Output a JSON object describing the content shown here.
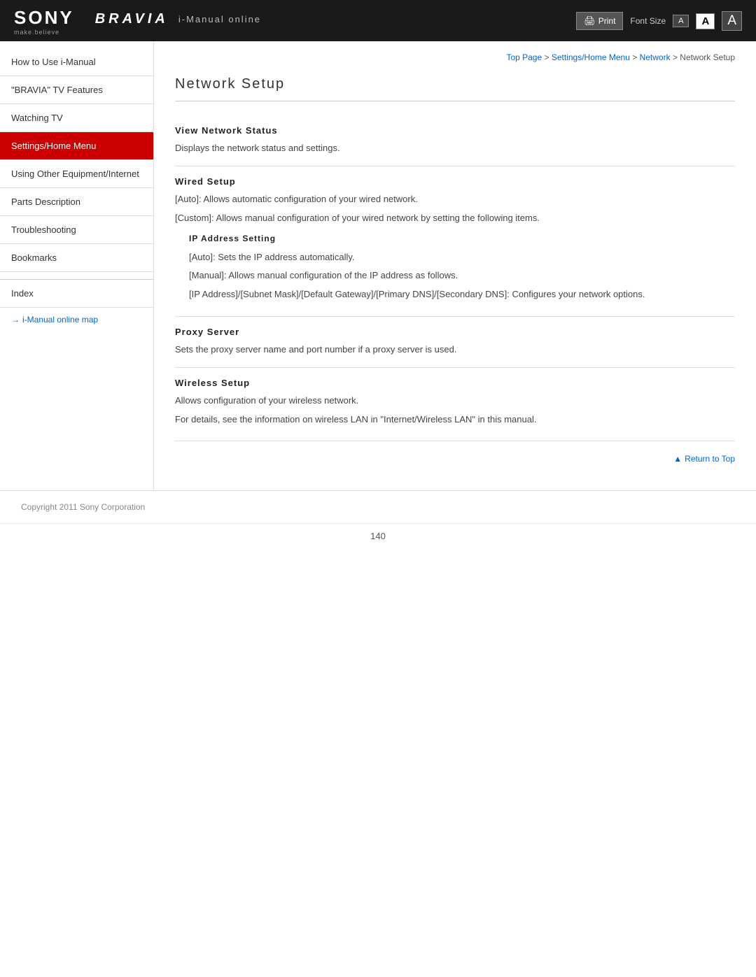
{
  "header": {
    "sony_logo": "SONY",
    "make_believe": "make.believe",
    "bravia_logo": "BRAVIA",
    "i_manual_text": "i-Manual online",
    "print_label": "Print",
    "font_size_label": "Font Size",
    "font_btn_small": "A",
    "font_btn_medium": "A",
    "font_btn_large": "A"
  },
  "breadcrumb": {
    "top_page": "Top Page",
    "separator1": " > ",
    "settings": "Settings/Home Menu",
    "separator2": " > ",
    "network": "Network",
    "separator3": " > ",
    "current": "Network Setup"
  },
  "sidebar": {
    "items": [
      {
        "label": "How to Use i-Manual",
        "active": false
      },
      {
        "label": "\"BRAVIA\" TV Features",
        "active": false
      },
      {
        "label": "Watching TV",
        "active": false
      },
      {
        "label": "Settings/Home Menu",
        "active": true
      },
      {
        "label": "Using Other Equipment/Internet",
        "active": false
      },
      {
        "label": "Parts Description",
        "active": false
      },
      {
        "label": "Troubleshooting",
        "active": false
      },
      {
        "label": "Bookmarks",
        "active": false
      }
    ],
    "index_label": "Index",
    "map_label": "i-Manual online map",
    "map_arrow": "→"
  },
  "content": {
    "page_title": "Network Setup",
    "sections": [
      {
        "id": "view-network-status",
        "title": "View  Network  Status",
        "body": "Displays the network status and settings."
      },
      {
        "id": "wired-setup",
        "title": "Wired Setup",
        "lines": [
          "[Auto]: Allows automatic configuration of your wired network.",
          "[Custom]: Allows manual configuration of your wired network by setting the following items."
        ],
        "subsections": [
          {
            "title": "IP  Address  Setting",
            "lines": [
              "[Auto]: Sets the IP address automatically.",
              "[Manual]: Allows manual configuration of the IP address as follows.",
              "[IP Address]/[Subnet Mask]/[Default Gateway]/[Primary DNS]/[Secondary DNS]: Configures your network options."
            ]
          }
        ]
      },
      {
        "id": "proxy-server",
        "title": "Proxy  Server",
        "body": "Sets the proxy server name and port number if a proxy server is used."
      },
      {
        "id": "wireless-setup",
        "title": "Wireless  Setup",
        "lines": [
          "Allows configuration of your wireless network.",
          "For details, see the information on wireless LAN in \"Internet/Wireless LAN\" in this manual."
        ]
      }
    ],
    "return_to_top": "Return to Top",
    "triangle_icon": "▲"
  },
  "footer": {
    "copyright": "Copyright 2011 Sony Corporation",
    "page_number": "140"
  }
}
